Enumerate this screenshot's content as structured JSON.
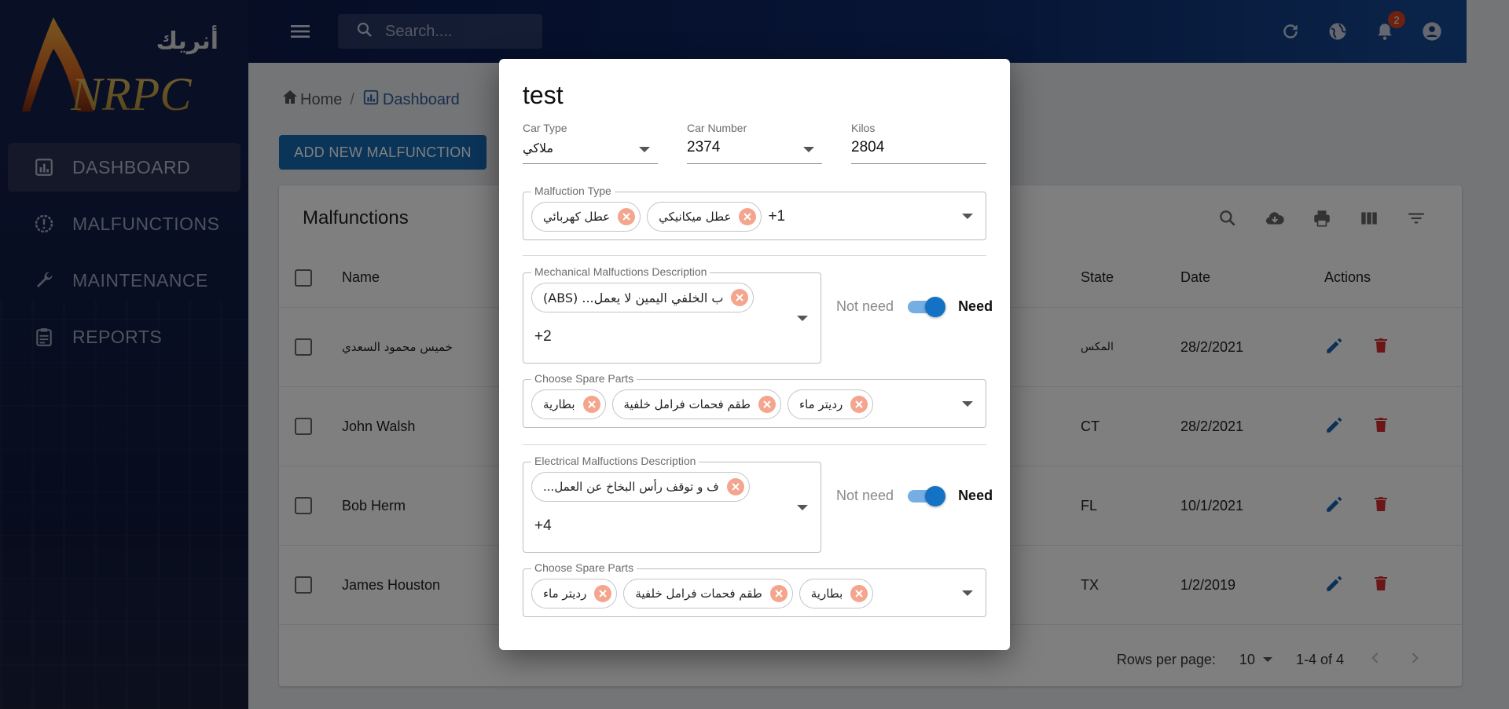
{
  "brand": {
    "logo_text": "NRPC",
    "logo_arabic": "أنريك"
  },
  "sidebar": {
    "items": [
      {
        "label": "DASHBOARD",
        "icon": "dashboard-icon",
        "active": true
      },
      {
        "label": "MALFUNCTIONS",
        "icon": "alert-gear-icon",
        "active": false
      },
      {
        "label": "MAINTENANCE",
        "icon": "wrench-icon",
        "active": false
      },
      {
        "label": "REPORTS",
        "icon": "clipboard-icon",
        "active": false
      }
    ]
  },
  "topbar": {
    "search_placeholder": "Search....",
    "notifications_count": "2"
  },
  "breadcrumb": {
    "home": "Home",
    "separator": "/",
    "current": "Dashboard"
  },
  "add_button": "ADD NEW MALFUNCTION",
  "table": {
    "title": "Malfunctions",
    "columns": {
      "name": "Name",
      "state": "State",
      "date": "Date",
      "actions": "Actions"
    },
    "rows": [
      {
        "name": "خميس محمود السعدي",
        "state": "المكس",
        "date": "28/2/2021"
      },
      {
        "name": "John Walsh",
        "state": "CT",
        "date": "28/2/2021"
      },
      {
        "name": "Bob Herm",
        "state": "FL",
        "date": "10/1/2021"
      },
      {
        "name": "James Houston",
        "state": "TX",
        "date": "1/2/2019"
      }
    ],
    "pagination": {
      "rows_per_page_label": "Rows per page:",
      "rows_per_page": "10",
      "range": "1-4 of 4"
    }
  },
  "dialog": {
    "title": "test",
    "car_type": {
      "label": "Car Type",
      "value": "ملاكي"
    },
    "car_number": {
      "label": "Car Number",
      "value": "2374"
    },
    "kilos": {
      "label": "Kilos",
      "value": "2804"
    },
    "malfunction_type": {
      "label": "Malfuction Type",
      "chips": [
        "عطل كهربائي",
        "عطل ميكانيكي"
      ],
      "more": "+1"
    },
    "mechanical": {
      "label": "Mechanical Malfuctions Description",
      "chips": [
        "(ABS) ...ب الخلفي اليمين لا يعمل"
      ],
      "more": "+2",
      "toggle_off": "Not need",
      "toggle_on": "Need"
    },
    "mechanical_parts": {
      "label": "Choose Spare Parts",
      "chips": [
        "بطارية",
        "طقم فحمات فرامل خلفية",
        "رديتر ماء"
      ]
    },
    "electrical": {
      "label": "Electrical Malfuctions Description",
      "chips": [
        "...ف و توقف رأس البخاخ عن العمل"
      ],
      "more": "+4",
      "toggle_off": "Not need",
      "toggle_on": "Need"
    },
    "electrical_parts": {
      "label": "Choose Spare Parts",
      "chips": [
        "رديتر ماء",
        "طقم فحمات فرامل خلفية",
        "بطارية"
      ]
    }
  },
  "colors": {
    "primary": "#1768b3",
    "chip_close": "#f4a58e",
    "delete": "#d32f2f",
    "badge": "#d9451f"
  }
}
